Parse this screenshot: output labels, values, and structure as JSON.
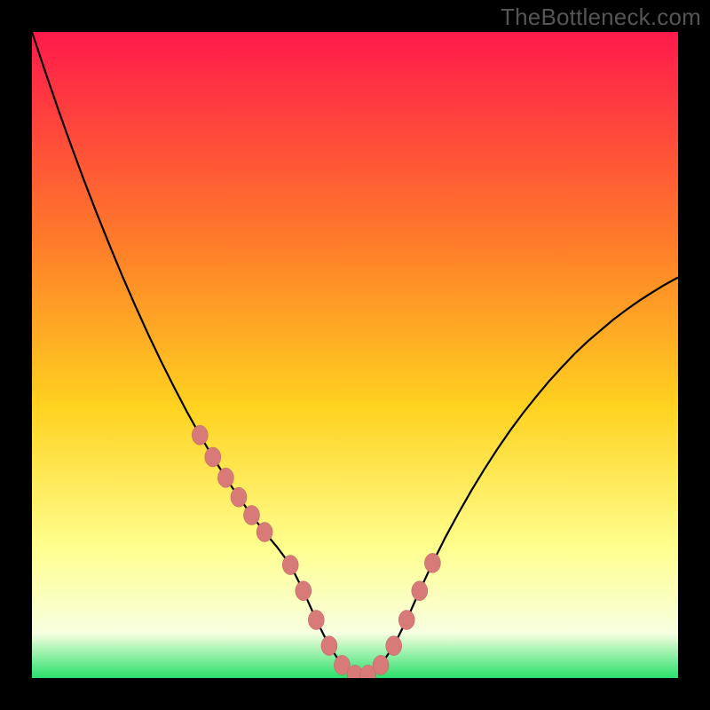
{
  "watermark": "TheBottleneck.com",
  "colors": {
    "frame": "#000000",
    "gradient_top": "#ff1a4b",
    "gradient_mid_upper": "#ff7a2a",
    "gradient_mid": "#ffd21f",
    "gradient_lower": "#ffff90",
    "gradient_pale": "#f8ffe0",
    "gradient_bottom": "#29e06b",
    "curve": "#000000",
    "marker_fill": "#d87a77",
    "marker_stroke": "#c06060"
  },
  "chart_data": {
    "type": "line",
    "title": "",
    "xlabel": "",
    "ylabel": "",
    "xlim": [
      0,
      100
    ],
    "ylim": [
      0,
      100
    ],
    "series": [
      {
        "name": "bottleneck-curve",
        "x": [
          0,
          2,
          4,
          6,
          8,
          10,
          12,
          14,
          16,
          18,
          20,
          22,
          24,
          26,
          28,
          30,
          32,
          34,
          36,
          38,
          40,
          42,
          44,
          46,
          48,
          50,
          52,
          54,
          56,
          58,
          60,
          62,
          64,
          66,
          68,
          70,
          72,
          74,
          76,
          78,
          80,
          82,
          84,
          86,
          88,
          90,
          92,
          94,
          96,
          98,
          100
        ],
        "y": [
          100,
          94,
          88.2,
          82.6,
          77.2,
          72,
          67,
          62.2,
          57.6,
          53.2,
          49,
          45,
          41.2,
          37.6,
          34.2,
          31,
          28,
          25.2,
          22.6,
          20.2,
          17.5,
          13.5,
          9,
          5,
          2,
          0.5,
          0.5,
          2.0,
          5.0,
          9.0,
          13.5,
          17.8,
          21.8,
          25.5,
          29.0,
          32.3,
          35.4,
          38.3,
          41.0,
          43.5,
          45.9,
          48.1,
          50.2,
          52.1,
          53.8,
          55.5,
          57.0,
          58.4,
          59.7,
          60.9,
          62.0
        ]
      }
    ],
    "markers": {
      "name": "bottleneck-points",
      "x": [
        26,
        28,
        30,
        32,
        34,
        36,
        40,
        42,
        44,
        46,
        48,
        50,
        52,
        54,
        56,
        58,
        60,
        62
      ],
      "y": [
        37.6,
        34.2,
        31,
        28,
        25.2,
        22.6,
        17.5,
        13.5,
        9,
        5,
        2,
        0.5,
        0.5,
        2.0,
        5.0,
        9.0,
        13.5,
        17.8
      ]
    }
  }
}
